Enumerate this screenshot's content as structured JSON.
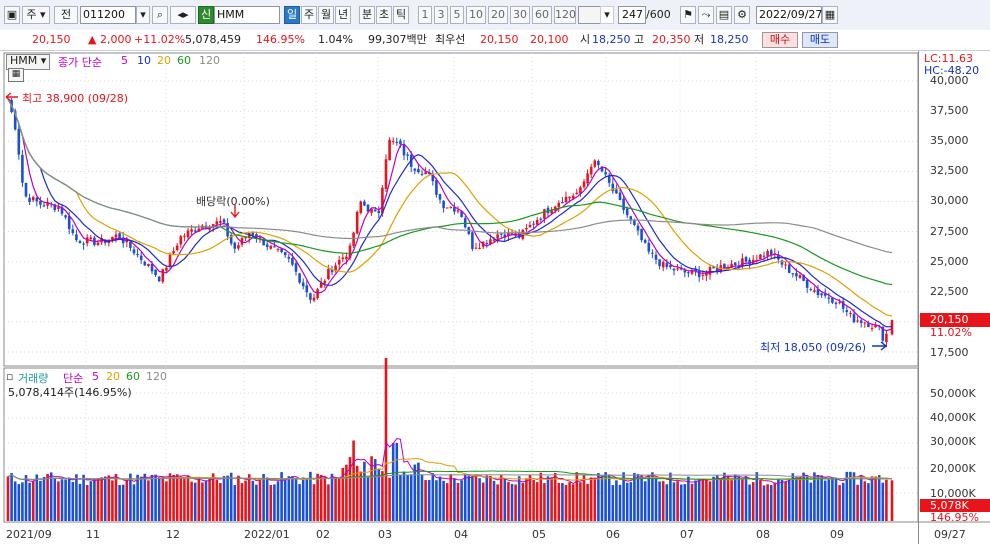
{
  "toolbar": {
    "market_label": "주",
    "type_label": "전",
    "code": "011200",
    "badge": "신",
    "name": "HMM",
    "period_tabs": [
      "일",
      "주",
      "월",
      "년",
      "분",
      "초",
      "틱"
    ],
    "active_period": "일",
    "minute_options": [
      "1",
      "3",
      "5",
      "10",
      "20",
      "30",
      "60",
      "120"
    ],
    "count_value": "247",
    "count_max": "/600",
    "date": "2022/09/27"
  },
  "quote": {
    "price": "20,150",
    "change": "2,000",
    "change_pct": "+11.02%",
    "volume": "5,078,459",
    "volume_ratio": "146.95%",
    "turnover": "1.04%",
    "amount": "99,307백만",
    "best_label": "최우선",
    "ask": "20,150",
    "bid": "20,100",
    "open_label": "시",
    "open": "18,250",
    "high_label": "고",
    "high": "20,350",
    "low_label": "저",
    "low": "18,250",
    "buy_label": "매수",
    "sell_label": "매도"
  },
  "price_panel": {
    "name_tag": "HMM",
    "legend_title": "종가 단순",
    "ma_periods": [
      "5",
      "10",
      "20",
      "60",
      "120"
    ],
    "lc": "LC:11.63",
    "hc": "HC:-48.20",
    "high_note": "최고 38,900 (09/28)",
    "low_note": "최저 18,050 (09/26)",
    "dividend_note": "배당락(0.00%)",
    "current_price_tag": "20,150",
    "current_pct_tag": "11.02%",
    "y_ticks": [
      "40,000",
      "37,500",
      "35,000",
      "32,500",
      "30,000",
      "27,500",
      "25,000",
      "22,500",
      "17,500"
    ]
  },
  "volume_panel": {
    "legend_title": "거래량",
    "legend_type": "단순",
    "ma_periods": [
      "5",
      "20",
      "60",
      "120"
    ],
    "current_volume": "5,078,414주(146.95%)",
    "y_ticks": [
      "50,000K",
      "40,000K",
      "30,000K",
      "20,000K",
      "10,000K"
    ],
    "current_tag": "5,078K",
    "current_pct_tag": "146.95%"
  },
  "x_axis": {
    "labels": [
      "2021/09",
      "11",
      "12",
      "2022/01",
      "02",
      "03",
      "04",
      "05",
      "06",
      "07",
      "08",
      "09",
      "09/27"
    ]
  },
  "colors": {
    "up": "#e8141b",
    "down": "#1a50d8",
    "ma5": "#c000c0",
    "ma10": "#1c2bd0",
    "ma20": "#e0a000",
    "ma60": "#1a9a1a",
    "ma120": "#8c8c8c"
  },
  "chart_data": {
    "type": "candlestick",
    "anchors": [
      {
        "date": "2021/09/28",
        "close": 38900,
        "note": "high"
      },
      {
        "date": "2022/03",
        "close": 37000
      },
      {
        "date": "2022/06",
        "close": 33500
      },
      {
        "date": "2022/09/26",
        "close": 18050,
        "note": "low"
      },
      {
        "date": "2022/09/27",
        "close": 20150
      }
    ],
    "last_volume": 5078414
  }
}
